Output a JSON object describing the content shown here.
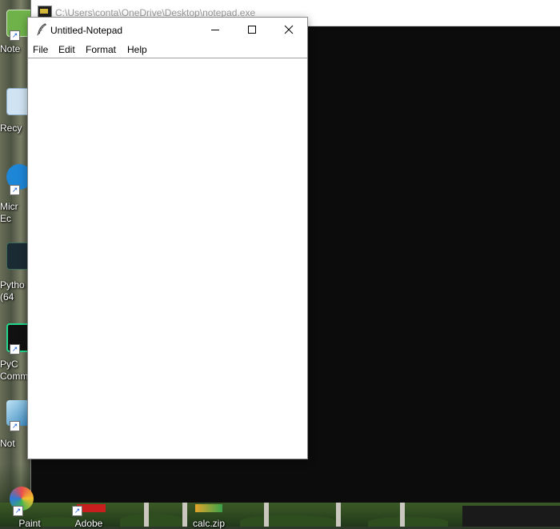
{
  "desktop": {
    "icons": [
      {
        "label": "Note"
      },
      {
        "label": "Recy"
      },
      {
        "label": "Micr\nEc"
      },
      {
        "label": "Pytho\n(64"
      },
      {
        "label": "PyC\nComm"
      },
      {
        "label": "Not"
      }
    ],
    "bottom_icons": [
      {
        "label": "Paint"
      },
      {
        "label": "Adobe"
      },
      {
        "label": "calc.zip"
      }
    ]
  },
  "console": {
    "title": "C:\\Users\\conta\\OneDrive\\Desktop\\notepad.exe",
    "icon": "console-app-icon"
  },
  "notepad": {
    "title": "Untitled-Notepad",
    "icon": "feather-icon",
    "controls": {
      "minimize_icon": "minimize-icon",
      "maximize_icon": "maximize-icon",
      "close_icon": "close-icon"
    },
    "menu": {
      "file": "File",
      "edit": "Edit",
      "format": "Format",
      "help": "Help"
    },
    "content": ""
  }
}
